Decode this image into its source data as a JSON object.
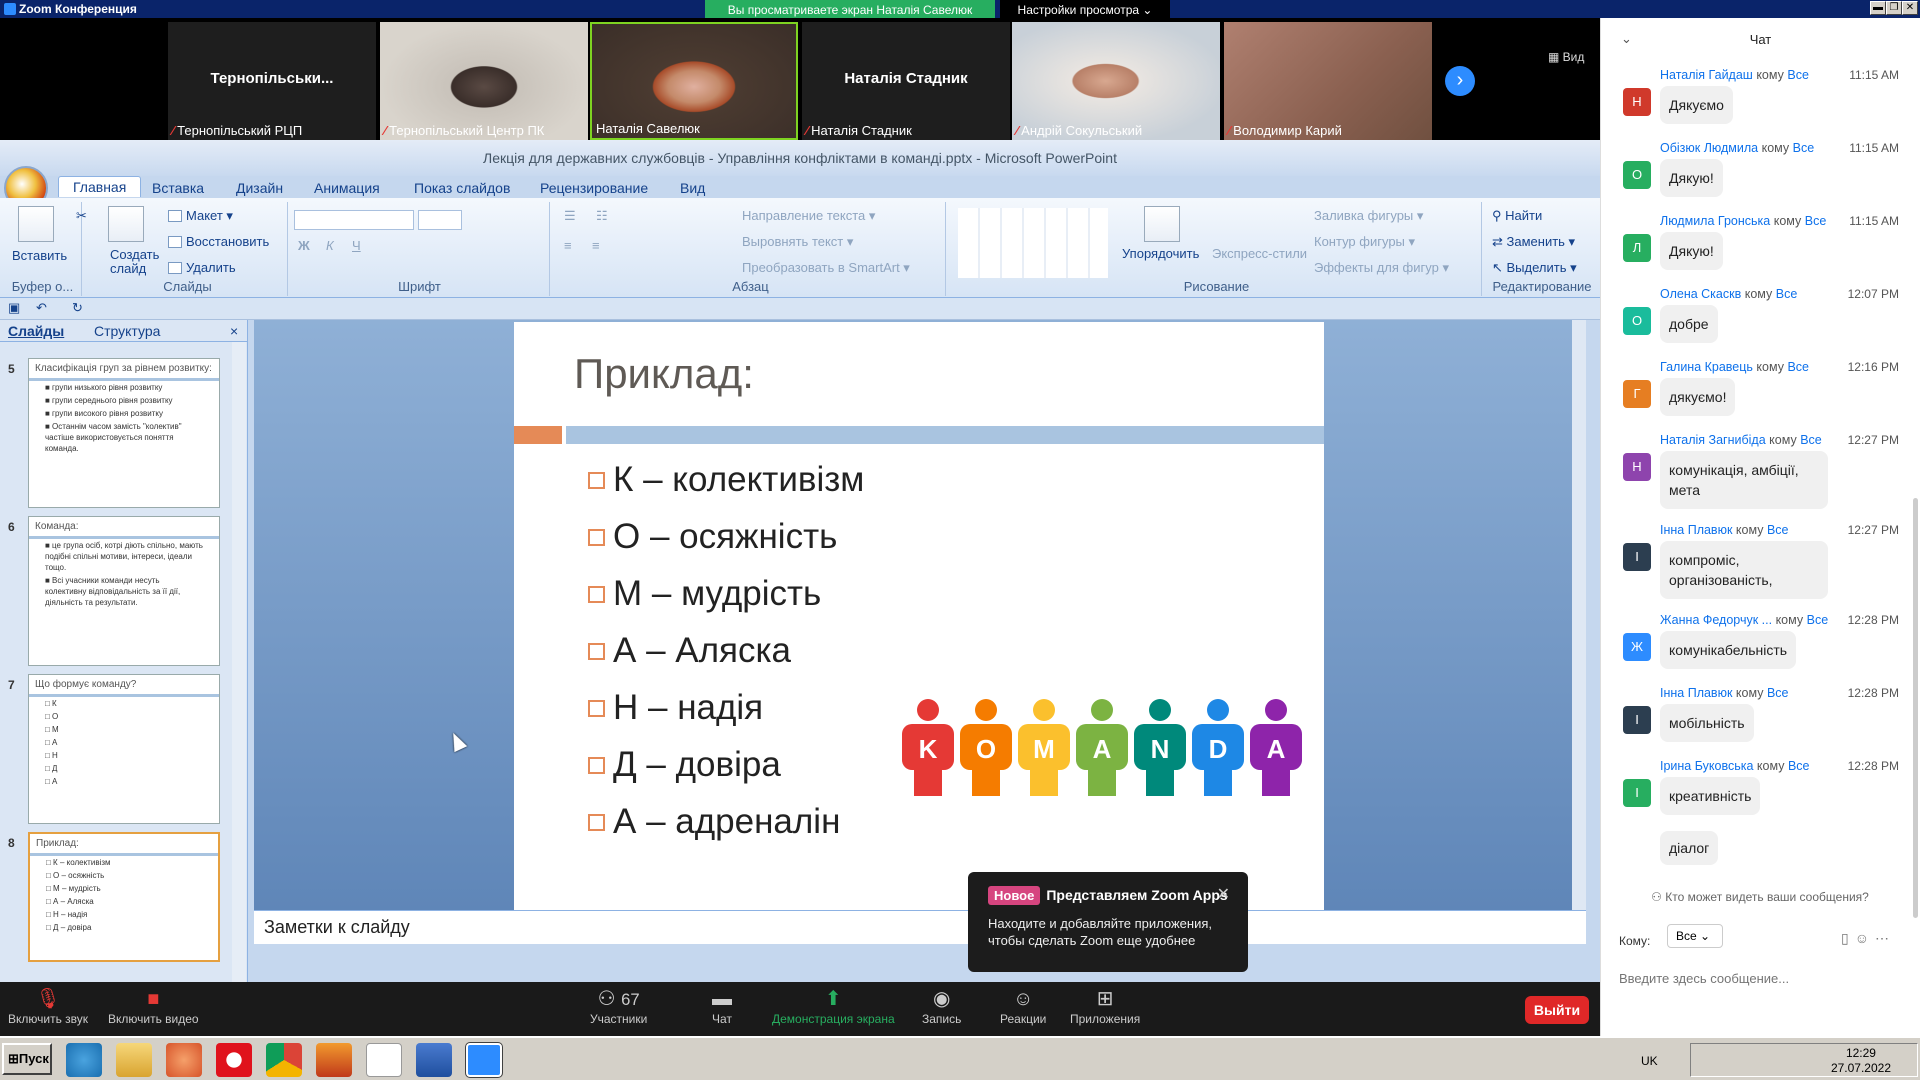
{
  "window": {
    "title": "Zoom Конференция",
    "viewing": "Вы просматриваете экран Наталія Савелюк",
    "view_options": "Настройки просмотра ⌄"
  },
  "video_strip": {
    "view_label": "Вид",
    "tiles": [
      {
        "big_name": "Тернопільськи...",
        "label": "Тернопільський РЦП"
      },
      {
        "big_name": "",
        "label": "Тернопільський Центр ПК"
      },
      {
        "big_name": "",
        "label": "Наталія Савелюк"
      },
      {
        "big_name": "Наталія Стадник",
        "label": "Наталія Стадник"
      },
      {
        "big_name": "",
        "label": "Андрій Сокульський"
      },
      {
        "big_name": "",
        "label": "Володимир Карий"
      }
    ]
  },
  "chat": {
    "title": "Чат",
    "to_word": "кому",
    "messages": [
      {
        "initial": "Н",
        "color": "#d0392b",
        "name": "Наталія Гайдаш",
        "to": "Все",
        "time": "11:15 AM",
        "text": "Дякуємо"
      },
      {
        "initial": "О",
        "color": "#27ae60",
        "name": "Обізюк Людмила",
        "to": "Все",
        "time": "11:15 AM",
        "text": "Дякую!"
      },
      {
        "initial": "Л",
        "color": "#27ae60",
        "name": "Людмила Гронська",
        "to": "Все",
        "time": "11:15 AM",
        "text": "Дякую!"
      },
      {
        "initial": "О",
        "color": "#1abc9c",
        "name": "Олена Скаскв",
        "to": "Все",
        "time": "12:07 PM",
        "text": "добре"
      },
      {
        "initial": "Г",
        "color": "#e67e22",
        "name": "Галина Кравець",
        "to": "Все",
        "time": "12:16 PM",
        "text": "дякуємо!"
      },
      {
        "initial": "Н",
        "color": "#8e44ad",
        "name": "Наталія Загнибіда",
        "to": "Все",
        "time": "12:27 PM",
        "text": "комунікація, амбіції, мета"
      },
      {
        "initial": "І",
        "color": "#2c3e50",
        "name": "Інна Плавюк",
        "to": "Все",
        "time": "12:27 PM",
        "text": "компроміс, організованість,"
      },
      {
        "initial": "Ж",
        "color": "#2d8cff",
        "name": "Жанна Федорчук ...",
        "to": "Все",
        "time": "12:28 PM",
        "text": "комунікабельність"
      },
      {
        "initial": "І",
        "color": "#2c3e50",
        "name": "Інна Плавюк",
        "to": "Все",
        "time": "12:28 PM",
        "text": "мобільність"
      },
      {
        "initial": "І",
        "color": "#27ae60",
        "name": "Ірина Буковська",
        "to": "Все",
        "time": "12:28 PM",
        "text": "креативність",
        "text2": "діалог"
      }
    ],
    "who_can_see": "Кто может видеть ваши сообщения?",
    "to_label": "Кому:",
    "to_value": "Все",
    "input_placeholder": "Введите здесь сообщение..."
  },
  "ppt": {
    "title": "Лекція для державних службовців - Управління конфліктами в команді.pptx - Microsoft PowerPoint",
    "tabs": [
      "Главная",
      "Вставка",
      "Дизайн",
      "Анимация",
      "Показ слайдов",
      "Рецензирование",
      "Вид"
    ],
    "groups": {
      "clipboard": "Буфер о...",
      "slides": "Слайды",
      "font": "Шрифт",
      "paragraph": "Абзац",
      "drawing": "Рисование",
      "editing": "Редактирование"
    },
    "buttons": {
      "paste": "Вставить",
      "new_slide": "Создать слайд",
      "layout": "Макет",
      "reset": "Восстановить",
      "delete": "Удалить",
      "text_dir": "Направление текста",
      "align_text": "Выровнять текст",
      "smartart": "Преобразовать в SmartArt",
      "arrange": "Упорядочить",
      "quick_styles": "Экспресс-стили",
      "fill": "Заливка фигуры",
      "outline": "Контур фигуры",
      "effects": "Эффекты для фигур",
      "find": "Найти",
      "replace": "Заменить",
      "select": "Выделить"
    },
    "panel_tabs": {
      "slides": "Слайды",
      "outline": "Структура"
    },
    "thumbs": [
      {
        "num": "5",
        "title": "Класифікація груп за рівнем розвитку:",
        "lines": [
          "■ групи низького рівня розвитку",
          "■ групи середнього рівня розвитку",
          "■ групи високого рівня розвитку",
          "■ Останнім часом замість \"колектив\" частіше використовується поняття команда."
        ]
      },
      {
        "num": "6",
        "title": "Команда:",
        "lines": [
          "■ це група осіб, котрі діють спільно, мають подібні спільні мотиви, інтереси, ідеали тощо.",
          "■ Всі учасники команди несуть колективну відповідальність за її дії, діяльність та результати."
        ]
      },
      {
        "num": "7",
        "title": "Що формує команду?",
        "lines": [
          "□ К",
          "□ О",
          "□ М",
          "□ А",
          "□ Н",
          "□ Д",
          "□ А"
        ]
      },
      {
        "num": "8",
        "title": "Приклад:",
        "lines": [
          "□ К – колективізм",
          "□ О – осяжність",
          "□ М – мудрість",
          "□ А – Аляска",
          "□ Н – надія",
          "□ Д – довіра"
        ]
      }
    ],
    "slide": {
      "title": "Приклад:",
      "bullets": [
        "К – колективізм",
        "О – осяжність",
        "М – мудрість",
        "А – Аляска",
        "Н – надія",
        "Д – довіра",
        "А – адреналін"
      ],
      "image_letters": [
        "K",
        "O",
        "M",
        "A",
        "N",
        "D",
        "A"
      ]
    },
    "notes_placeholder": "Заметки к слайду"
  },
  "zoom_apps": {
    "badge": "Новое",
    "heading": "Представляем Zoom Apps",
    "desc": "Находите и добавляйте приложения, чтобы сделать Zoom еще удобнее"
  },
  "toolbar": {
    "mute": "Включить звук",
    "video": "Включить видео",
    "participants": "Участники",
    "participants_count": "67",
    "chat": "Чат",
    "share": "Демонстрация экрана",
    "record": "Запись",
    "reactions": "Реакции",
    "apps": "Приложения",
    "leave": "Выйти"
  },
  "taskbar": {
    "start": "Пуск",
    "lang": "UK",
    "time": "12:29",
    "date": "27.07.2022"
  }
}
